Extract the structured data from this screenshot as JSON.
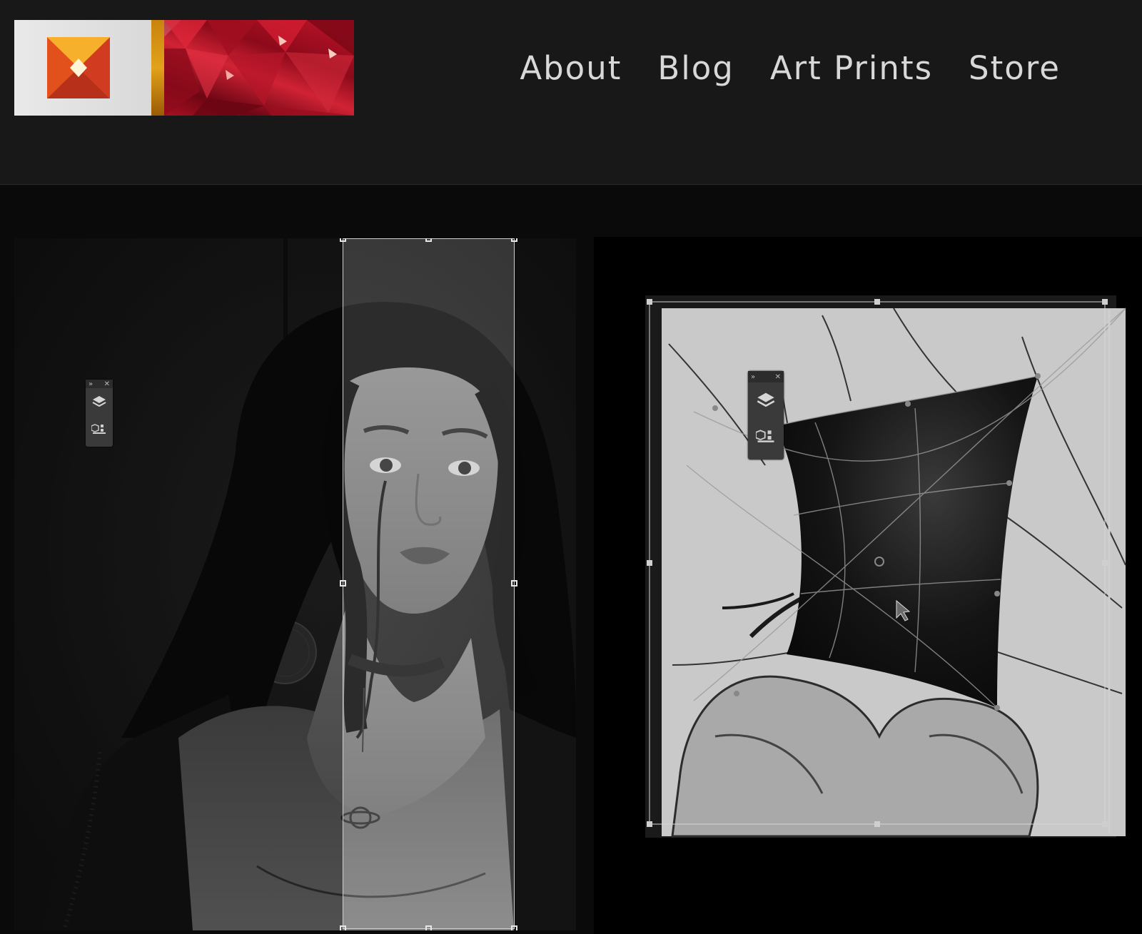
{
  "nav": {
    "items": [
      "About",
      "Blog",
      "Art Prints",
      "Store"
    ]
  },
  "palette": {
    "collapse_glyph": "»",
    "close_glyph": "✕",
    "icons": [
      "layers-icon",
      "3d-object-icon"
    ]
  },
  "colors": {
    "header_bg": "#181818",
    "page_bg": "#0a0a0a",
    "nav_text": "#d8d8d8",
    "logo_orange": "#f08a1c",
    "logo_red": "#c0142b"
  }
}
